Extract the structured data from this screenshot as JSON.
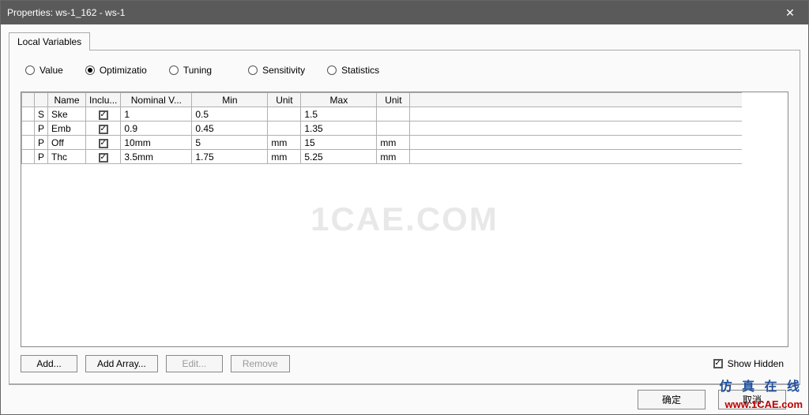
{
  "window": {
    "title": "Properties: ws-1_162 - ws-1"
  },
  "tabs": {
    "local_variables": "Local Variables"
  },
  "modes": {
    "value": "Value",
    "optimization": "Optimizatio",
    "tuning": "Tuning",
    "sensitivity": "Sensitivity",
    "statistics": "Statistics",
    "selected": "optimization"
  },
  "grid": {
    "headers": {
      "name": "Name",
      "include": "Inclu...",
      "nominal": "Nominal V...",
      "min": "Min",
      "unit1": "Unit",
      "max": "Max",
      "unit2": "Unit"
    },
    "rows": [
      {
        "type": "S",
        "name": "Ske",
        "include": true,
        "nominal": "1",
        "min": "0.5",
        "unit1": "",
        "max": "1.5",
        "unit2": ""
      },
      {
        "type": "P",
        "name": "Emb",
        "include": true,
        "nominal": "0.9",
        "min": "0.45",
        "unit1": "",
        "max": "1.35",
        "unit2": ""
      },
      {
        "type": "P",
        "name": "Off",
        "include": true,
        "nominal": "10mm",
        "min": "5",
        "unit1": "mm",
        "max": "15",
        "unit2": "mm"
      },
      {
        "type": "P",
        "name": "Thc",
        "include": true,
        "nominal": "3.5mm",
        "min": "1.75",
        "unit1": "mm",
        "max": "5.25",
        "unit2": "mm"
      }
    ]
  },
  "buttons": {
    "add": "Add...",
    "add_array": "Add Array...",
    "edit": "Edit...",
    "remove": "Remove"
  },
  "show_hidden": {
    "label": "Show Hidden",
    "checked": true
  },
  "footer": {
    "ok": "确定",
    "cancel": "取消"
  },
  "watermark": "1CAE.COM",
  "brand": {
    "text": "仿 真 在 线",
    "url": "www.1CAE.com"
  }
}
